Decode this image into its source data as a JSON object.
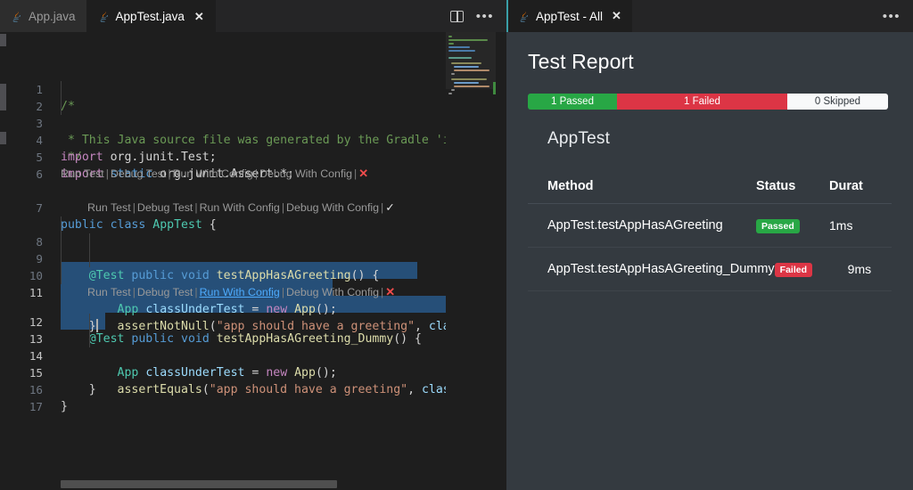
{
  "editor": {
    "tabs": [
      {
        "label": "App.java",
        "icon": "java-icon",
        "active": false,
        "closable": false
      },
      {
        "label": "AppTest.java",
        "icon": "java-icon",
        "active": true,
        "closable": true,
        "close_label": "✕"
      }
    ],
    "actions": [
      {
        "name": "split-editor-icon",
        "label": ""
      },
      {
        "name": "more-actions-icon",
        "label": "•••"
      }
    ],
    "line_numbers": [
      "1",
      "2",
      "3",
      "4",
      "5",
      "6",
      "7",
      "8",
      "9",
      "10",
      "11",
      "12",
      "13",
      "14",
      "15",
      "16",
      "17"
    ],
    "lines": [
      {
        "n": "1",
        "text": "/*"
      },
      {
        "n": "2",
        "text": " * This Java source file was generated by the Gradle 'init'"
      },
      {
        "n": "3",
        "text": " */"
      },
      {
        "n": "4",
        "text": "import org.junit.Test;"
      },
      {
        "n": "5",
        "text": "import static org.junit.Assert.*;"
      },
      {
        "n": "6",
        "text": ""
      },
      {
        "n": "7",
        "text": "public class AppTest {"
      },
      {
        "n": "8",
        "text": "    @Test public void testAppHasAGreeting() {"
      },
      {
        "n": "9",
        "text": "        App classUnderTest = new App();"
      },
      {
        "n": "10",
        "text": "        assertNotNull(\"app should have a greeting\", classUn"
      },
      {
        "n": "11",
        "text": "    }"
      },
      {
        "n": "12",
        "text": "    @Test public void testAppHasAGreeting_Dummy() {"
      },
      {
        "n": "13",
        "text": "        App classUnderTest = new App();"
      },
      {
        "n": "14",
        "text": "        assertEquals(\"app should have a greeting\", classUnd"
      },
      {
        "n": "15",
        "text": "    }"
      },
      {
        "n": "16",
        "text": "}"
      },
      {
        "n": "17",
        "text": ""
      }
    ],
    "codelens": [
      {
        "id": "class-lens",
        "run_test": "Run Test",
        "debug_test": "Debug Test",
        "run_with_config": "Run With Config",
        "debug_with_config": "Debug With Config",
        "status_glyph": "✕",
        "status": "failed",
        "hovered": false
      },
      {
        "id": "test1-lens",
        "run_test": "Run Test",
        "debug_test": "Debug Test",
        "run_with_config": "Run With Config",
        "debug_with_config": "Debug With Config",
        "status_glyph": "✓",
        "status": "passed",
        "hovered": false
      },
      {
        "id": "test2-lens",
        "run_test": "Run Test",
        "debug_test": "Debug Test",
        "run_with_config": "Run With Config",
        "debug_with_config": "Debug With Config",
        "status_glyph": "✕",
        "status": "failed",
        "hovered": true
      }
    ],
    "separator": "|"
  },
  "report": {
    "tab": {
      "label": "AppTest - All",
      "icon": "java-icon",
      "close_label": "✕"
    },
    "more_actions_label": "•••",
    "title": "Test Report",
    "suite_name": "AppTest",
    "summary": [
      {
        "label": "1 Passed",
        "kind": "passed",
        "color": "#28a745"
      },
      {
        "label": "1 Failed",
        "kind": "failed",
        "color": "#dc3545"
      },
      {
        "label": "0 Skipped",
        "kind": "skipped",
        "color": "#f8f9fa"
      }
    ],
    "columns": [
      "Method",
      "Status",
      "Durat"
    ],
    "rows": [
      {
        "method": "AppTest.testAppHasAGreeting",
        "status": "Passed",
        "status_kind": "pass",
        "duration": "1ms"
      },
      {
        "method": "AppTest.testAppHasAGreeting_Dummy",
        "status": "Failed",
        "status_kind": "fail",
        "duration": "9ms"
      }
    ]
  }
}
